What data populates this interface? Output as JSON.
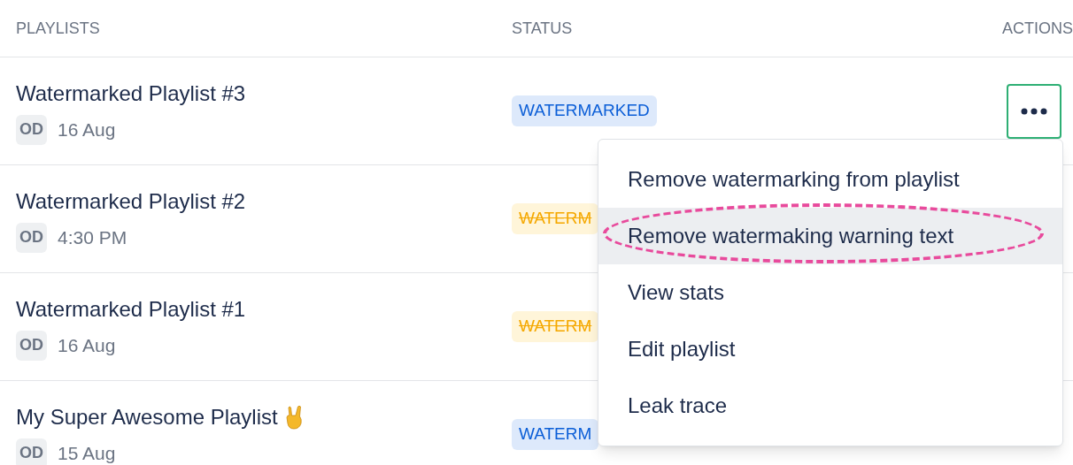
{
  "table": {
    "columns": [
      "PLAYLISTS",
      "STATUS",
      "ACTIONS"
    ],
    "rows": [
      {
        "title": "Watermarked Playlist #3",
        "emoji": false,
        "owner": "OD",
        "date": "16 Aug",
        "status": {
          "text": "WATERMARKED",
          "struck": false
        },
        "menu_button": true
      },
      {
        "title": "Watermarked Playlist #2",
        "emoji": false,
        "owner": "OD",
        "date": "4:30 PM",
        "status": {
          "text": "WATERM",
          "struck": true
        },
        "menu_button": false
      },
      {
        "title": "Watermarked Playlist #1",
        "emoji": false,
        "owner": "OD",
        "date": "16 Aug",
        "status": {
          "text": "WATERM",
          "struck": true
        },
        "menu_button": false
      },
      {
        "title": "My Super Awesome Playlist",
        "emoji": true,
        "owner": "OD",
        "date": "15 Aug",
        "status": {
          "text": "WATERM",
          "struck": false
        },
        "menu_button": false
      }
    ]
  },
  "menu": {
    "items": [
      {
        "label": "Remove watermarking from playlist",
        "highlighted": false,
        "circled": false
      },
      {
        "label": "Remove watermaking warning text",
        "highlighted": true,
        "circled": true
      },
      {
        "label": "View stats",
        "highlighted": false,
        "circled": false
      },
      {
        "label": "Edit playlist",
        "highlighted": false,
        "circled": false
      },
      {
        "label": "Leak trace",
        "highlighted": false,
        "circled": false
      }
    ]
  }
}
